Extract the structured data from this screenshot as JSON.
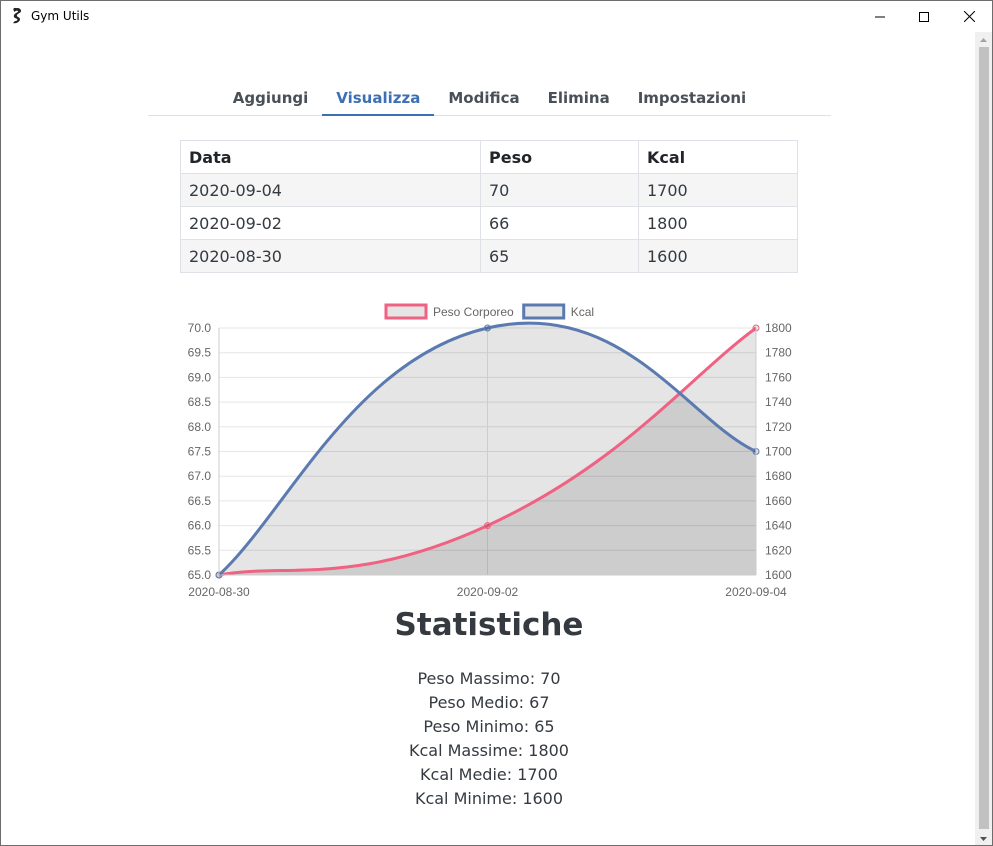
{
  "window": {
    "title": "Gym Utils"
  },
  "tabs": [
    {
      "label": "Aggiungi"
    },
    {
      "label": "Visualizza"
    },
    {
      "label": "Modifica"
    },
    {
      "label": "Elimina"
    },
    {
      "label": "Impostazioni"
    }
  ],
  "active_tab": "Visualizza",
  "table": {
    "headers": [
      "Data",
      "Peso",
      "Kcal"
    ],
    "rows": [
      [
        "2020-09-04",
        "70",
        "1700"
      ],
      [
        "2020-09-02",
        "66",
        "1800"
      ],
      [
        "2020-08-30",
        "65",
        "1600"
      ]
    ]
  },
  "chart_data": {
    "type": "line",
    "x": [
      "2020-08-30",
      "2020-09-02",
      "2020-09-04"
    ],
    "series": [
      {
        "name": "Peso Corporeo",
        "values": [
          65,
          66,
          70
        ],
        "color": "#f06283",
        "axis": "left"
      },
      {
        "name": "Kcal",
        "values": [
          1600,
          1800,
          1700
        ],
        "color": "#5a7ab0",
        "axis": "right"
      }
    ],
    "y_left": {
      "range": [
        65,
        70
      ],
      "ticks": [
        "70.0",
        "69.5",
        "69.0",
        "68.5",
        "68.0",
        "67.5",
        "67.0",
        "66.5",
        "66.0",
        "65.5",
        "65.0"
      ]
    },
    "y_right": {
      "range": [
        1600,
        1800
      ],
      "ticks": [
        "1800",
        "1780",
        "1760",
        "1740",
        "1720",
        "1700",
        "1680",
        "1660",
        "1640",
        "1620",
        "1600"
      ]
    },
    "fill": true,
    "legend": "top",
    "grid": true
  },
  "stats": {
    "title": "Statistiche",
    "lines": [
      "Peso Massimo: 70",
      "Peso Medio: 67",
      "Peso Minimo: 65",
      "Kcal Massime: 1800",
      "Kcal Medie: 1700",
      "Kcal Minime: 1600"
    ]
  }
}
